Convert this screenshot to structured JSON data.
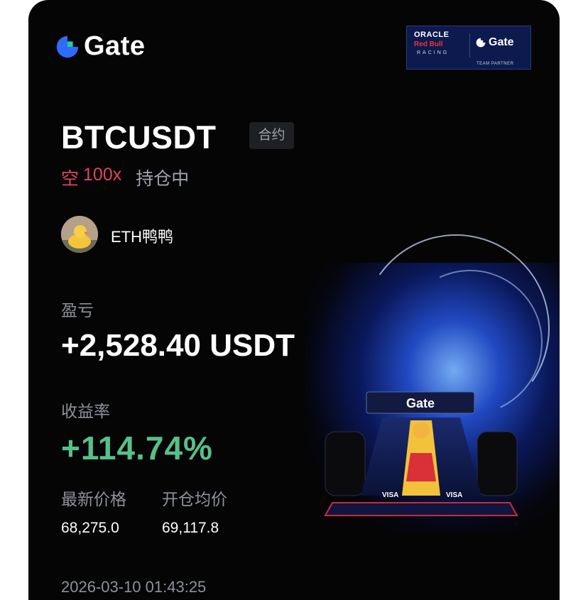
{
  "brand": {
    "name": "Gate"
  },
  "partner": {
    "oracle": "ORACLE",
    "redbull": "Red Bull",
    "racing": "RACING",
    "gate": "Gate",
    "team_partner": "TEAM PARTNER"
  },
  "contract": {
    "pair": "BTCUSDT",
    "type_tag": "合约",
    "direction": "空",
    "leverage": "100x",
    "status": "持仓中"
  },
  "user": {
    "name": "ETH鸭鸭"
  },
  "pnl": {
    "label": "盈亏",
    "value": "+2,528.40 USDT"
  },
  "roi": {
    "label": "收益率",
    "value": "+114.74%"
  },
  "prices": {
    "latest_label": "最新价格",
    "latest_value": "68,275.0",
    "entry_label": "开仓均价",
    "entry_value": "69,117.8"
  },
  "timestamp": "2026-03-10 01:43:25",
  "colors": {
    "background": "#050506",
    "short": "#e0455a",
    "profit": "#57c08a",
    "muted": "#8d9199",
    "brand_blue": "#2f6bff"
  }
}
